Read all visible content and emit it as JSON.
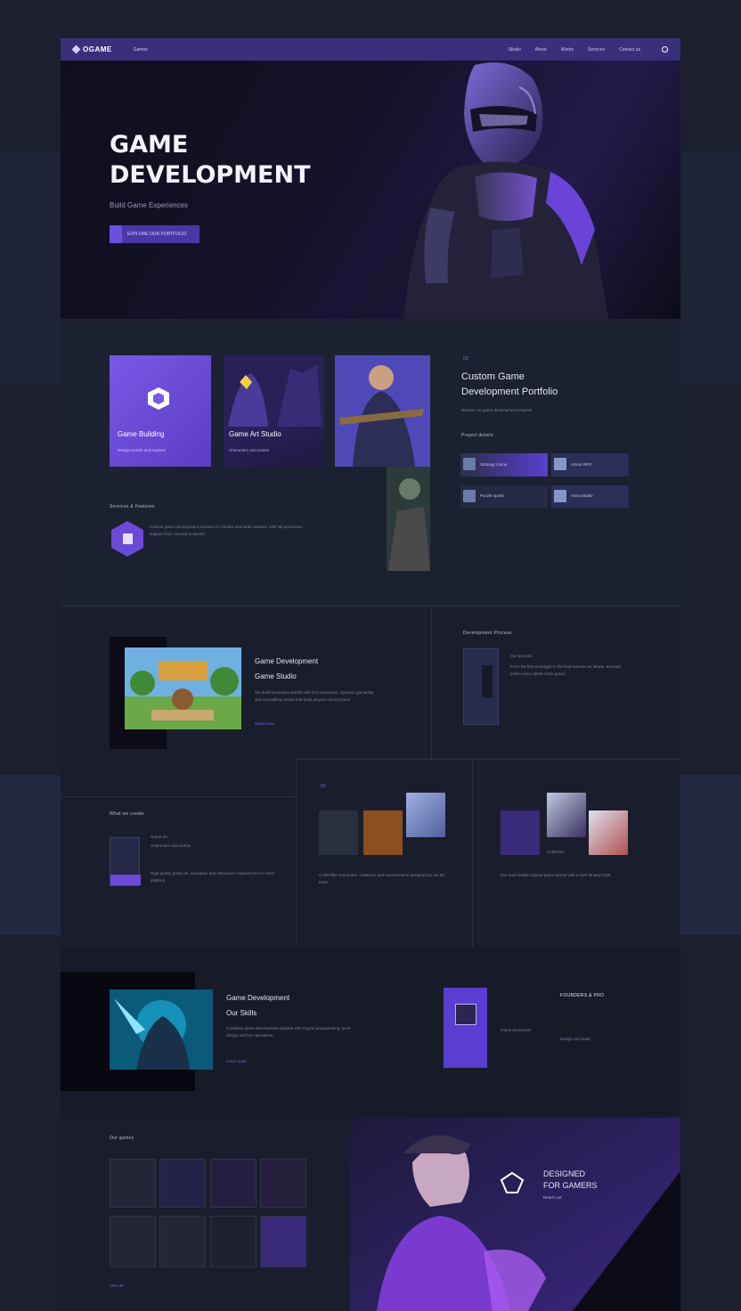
{
  "nav": {
    "logo": "OGAME",
    "small_link": "Games",
    "menu": [
      "Studio",
      "About",
      "Works",
      "Services",
      "Contact us"
    ]
  },
  "hero": {
    "title_line1": "GAME",
    "title_line2": "DEVELOPMENT",
    "subtitle": "Build Game Experiences",
    "cta": "EXPLORE OUR PORTFOLIO"
  },
  "features": {
    "card1_title": "Game Building",
    "card1_sub": "Design worlds and engines",
    "card2_title": "Game Art Studio",
    "card2_sub": "Characters and assets",
    "portfolio_num": "01",
    "portfolio_title_1": "Custom Game",
    "portfolio_title_2": "Development Portfolio",
    "portfolio_sub": "Browse our game development projects",
    "portfolio_tag": "Project details",
    "mini_rows": [
      "Strategy Game",
      "Action RPG",
      "Puzzle Quest",
      "Arena Battle"
    ]
  },
  "services": {
    "label": "Services & Features",
    "text": "Custom game development services for studios and indie creators, with full production support from concept to launch."
  },
  "showcase": {
    "title1": "Game Development",
    "title2": "Game Studio",
    "text": "We build immersive worlds with rich characters, dynamic gameplay and compelling stories that keep players coming back.",
    "link": "Read more"
  },
  "process": {
    "label": "Development Process",
    "intro": "Our process",
    "text": "From the first prototype to the final release we iterate, test and polish every detail of the game."
  },
  "lower": {
    "label": "What we create",
    "small_title": "Game art",
    "small_sub": "Characters and worlds",
    "text": "High quality game art, animation and interactive experiences for every platform.",
    "num": "02",
    "mid_text": "Collectible characters, creatures and environments designed by our art team.",
    "right_caption": "Collection",
    "right_text": "Our team builds original game assets with a dark fantasy style."
  },
  "feature2": {
    "title1": "Game Development",
    "title2": "Our Skills",
    "text": "Complete game development pipeline with engine programming, level design and live operations.",
    "link": "Learn more",
    "side_title": "FOUNDERS & PRO",
    "side_text1": "Game production",
    "side_text2": "Design and build"
  },
  "gallery": {
    "label": "Our games",
    "bottom_link": "View all",
    "right_title1": "DESIGNED",
    "right_title2": "FOR GAMERS",
    "right_sub": "Reach out"
  },
  "colors": {
    "accent": "#6d4fe0",
    "nav_bg": "#3a2f7a",
    "page_bg": "#1a1e2c"
  }
}
